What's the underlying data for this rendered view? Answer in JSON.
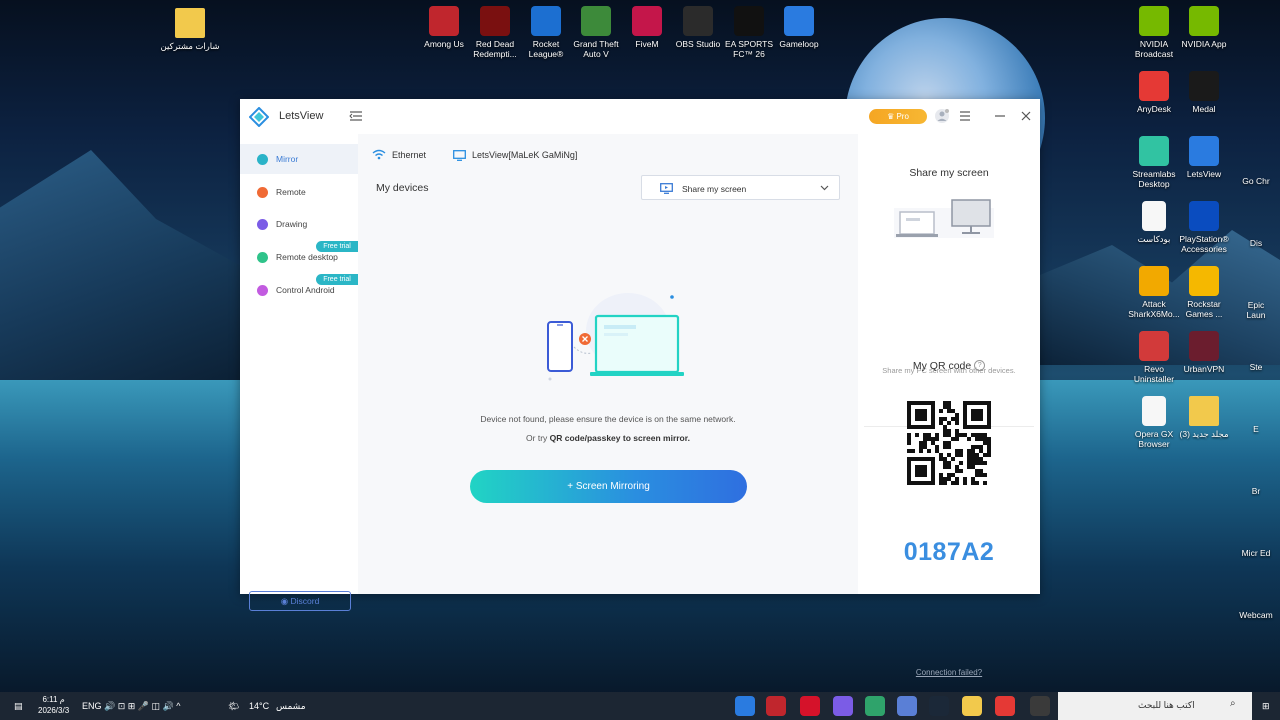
{
  "desktop": {
    "left_icons": [
      {
        "label": "شارات مشتركين",
        "icon": "folder-icon"
      }
    ],
    "top_icons": [
      {
        "label": "Among Us",
        "icon": "among-us-icon",
        "color": "#c0262d"
      },
      {
        "label": "Red Dead Redempti...",
        "icon": "red-dead-icon",
        "color": "#7a1010"
      },
      {
        "label": "Rocket League®",
        "icon": "rocket-league-icon",
        "color": "#1c6fd1"
      },
      {
        "label": "Grand Theft Auto V",
        "icon": "gta-icon",
        "color": "#3d8a3a"
      },
      {
        "label": "FiveM",
        "icon": "fivem-icon",
        "color": "#c4164a"
      },
      {
        "label": "OBS Studio",
        "icon": "obs-icon",
        "color": "#2b2b2b"
      },
      {
        "label": "EA SPORTS FC™ 26",
        "icon": "ea-fc-icon",
        "color": "#111111"
      },
      {
        "label": "Gameloop",
        "icon": "gameloop-icon",
        "color": "#2a7be0"
      }
    ],
    "right_icons": [
      {
        "label": "NVIDIA Broadcast",
        "icon": "nvidia-broadcast-icon",
        "color": "#76b900"
      },
      {
        "label": "NVIDIA App",
        "icon": "nvidia-app-icon",
        "color": "#76b900"
      },
      {
        "label": "AnyDesk",
        "icon": "anydesk-icon",
        "color": "#e53935"
      },
      {
        "label": "Medal",
        "icon": "medal-icon",
        "color": "#1a1a1a"
      },
      {
        "label": "Streamlabs Desktop",
        "icon": "streamlabs-icon",
        "color": "#31c3a2"
      },
      {
        "label": "LetsView",
        "icon": "letsview-icon",
        "color": "#2a7be0"
      },
      {
        "label": "بودكاست",
        "icon": "document-icon",
        "color": "#eeeeee"
      },
      {
        "label": "PlayStation® Accessories",
        "icon": "playstation-icon",
        "color": "#0a4cbf"
      },
      {
        "label": "Attack SharkX6Mo...",
        "icon": "attack-shark-icon",
        "color": "#f2a900"
      },
      {
        "label": "Rockstar Games ...",
        "icon": "rockstar-icon",
        "color": "#f5b800"
      },
      {
        "label": "Revo Uninstaller",
        "icon": "revo-icon",
        "color": "#d23a3a"
      },
      {
        "label": "UrbanVPN",
        "icon": "urbanvpn-icon",
        "color": "#6b1d2e"
      },
      {
        "label": "Opera GX Browser",
        "icon": "document-icon",
        "color": "#eeeeee"
      },
      {
        "label": "مجلد جديد (3)",
        "icon": "folder-icon",
        "color": "#f2c94c"
      }
    ],
    "edge_labels": [
      "Go Chr",
      "Dis",
      "Epic Laun",
      "Ste",
      "E",
      "Br",
      "Micr Ed",
      "Webcam"
    ]
  },
  "window": {
    "app_title": "LetsView",
    "pro_label": "Pro",
    "sidebar": {
      "items": [
        {
          "label": "Mirror",
          "color": "#2ab3c8",
          "active": true
        },
        {
          "label": "Remote",
          "color": "#f06a35"
        },
        {
          "label": "Drawing",
          "color": "#7b5ce6"
        },
        {
          "label": "Remote desktop",
          "color": "#2fc38a",
          "trial": "Free trial"
        },
        {
          "label": "Control Android",
          "color": "#c25be0",
          "trial": "Free trial"
        }
      ],
      "discord_label": "Discord"
    },
    "main": {
      "ethernet_label": "Ethernet",
      "device_name": "LetsView[MaLeK GaMiNg]",
      "my_devices": "My devices",
      "share_select": "Share my screen",
      "not_found": "Device not found, please ensure the device is on the same network.",
      "or_try": "Or try ",
      "or_try_bold": "QR code/passkey to screen mirror.",
      "mirror_button": "+ Screen Mirroring"
    },
    "right": {
      "share_title": "Share my screen",
      "share_sub": "Share my PC screen with other devices.",
      "qr_title": "My QR code",
      "code": "0187A2",
      "connection_failed": "Connection failed?"
    }
  },
  "taskbar": {
    "time": "6:11 م",
    "date": "2026/3/3",
    "lang": "ENG",
    "weather_temp": "14°C",
    "weather_text": "مشمس",
    "search_placeholder": "اكتب هنا للبحث"
  }
}
